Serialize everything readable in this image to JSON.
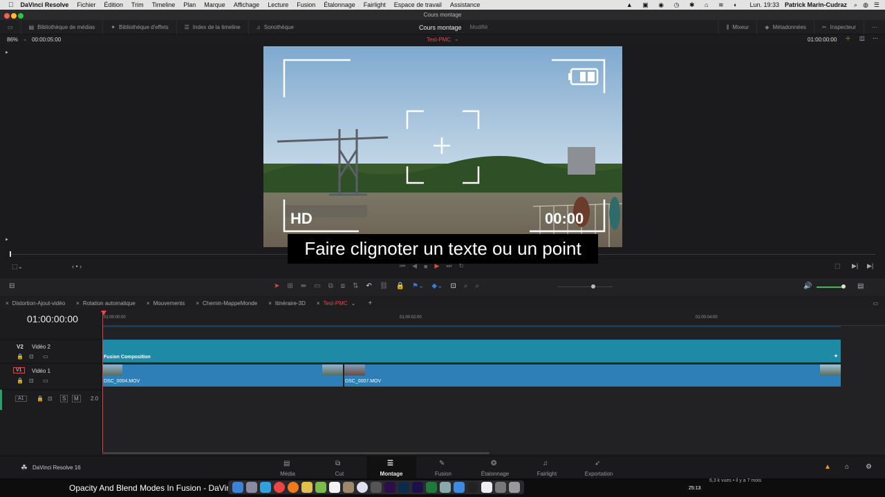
{
  "menubar": {
    "app": "DaVinci Resolve",
    "items": [
      "Fichier",
      "Édition",
      "Trim",
      "Timeline",
      "Plan",
      "Marque",
      "Affichage",
      "Lecture",
      "Fusion",
      "Étalonnage",
      "Fairlight",
      "Espace de travail",
      "Assistance"
    ],
    "clock": "Lun. 19:33",
    "user": "Patrick Marin-Cudraz"
  },
  "window": {
    "title": "Cours montage"
  },
  "toolbar": {
    "media_pool": "Bibliothèque de médias",
    "effects_library": "Bibliothèque d'effets",
    "timeline_index": "Index de la timeline",
    "sound_library": "Sonothèque",
    "project_name": "Cours montage",
    "status": "Modifié",
    "mixer": "Mixeur",
    "metadata": "Métadonnées",
    "inspector": "Inspecteur"
  },
  "viewer": {
    "zoom": "86%",
    "duration": "00:00:05:00",
    "timeline_name": "Test-PMC",
    "timecode": "01:00:00:00",
    "overlay_hd": "HD",
    "overlay_time": "00:00"
  },
  "subtitle": "Faire clignoter un texte ou un point",
  "timeline_tabs": [
    "Distortion-Ajout-vidéo",
    "Rotation automatique",
    "Mouvements",
    "Chemin-MappeMonde",
    "Itinéraire-3D",
    "Test-PMC"
  ],
  "timeline": {
    "current_timecode": "01:00:00:00",
    "ruler": [
      "01:00:00:00",
      "01:00:02:00",
      "01:00:04:00"
    ],
    "tracks": [
      {
        "id": "V2",
        "name": "Vidéo 2"
      },
      {
        "id": "V1",
        "name": "Vidéo 1"
      },
      {
        "id": "A1",
        "name": "",
        "level": "2.0"
      }
    ],
    "clips": {
      "fusion": "Fusion Composition",
      "clip1": "DSC_0004.MOV",
      "clip2": "DSC_0007.MOV"
    }
  },
  "pages": [
    "Média",
    "Cut",
    "Montage",
    "Fusion",
    "Étalonnage",
    "Fairlight",
    "Exportation"
  ],
  "active_page": "Montage",
  "footer": {
    "app_version": "DaVinci Resolve 16"
  },
  "youtube": {
    "title": "Opacity And Blend Modes In Fusion - DaVinci",
    "views": "6,3 k vues • il y a 7 mois",
    "time": "25:13"
  },
  "colors": {
    "accent_red": "#e24a4a",
    "clip_teal": "#1e8aa6",
    "clip_blue": "#2e7fb8"
  }
}
